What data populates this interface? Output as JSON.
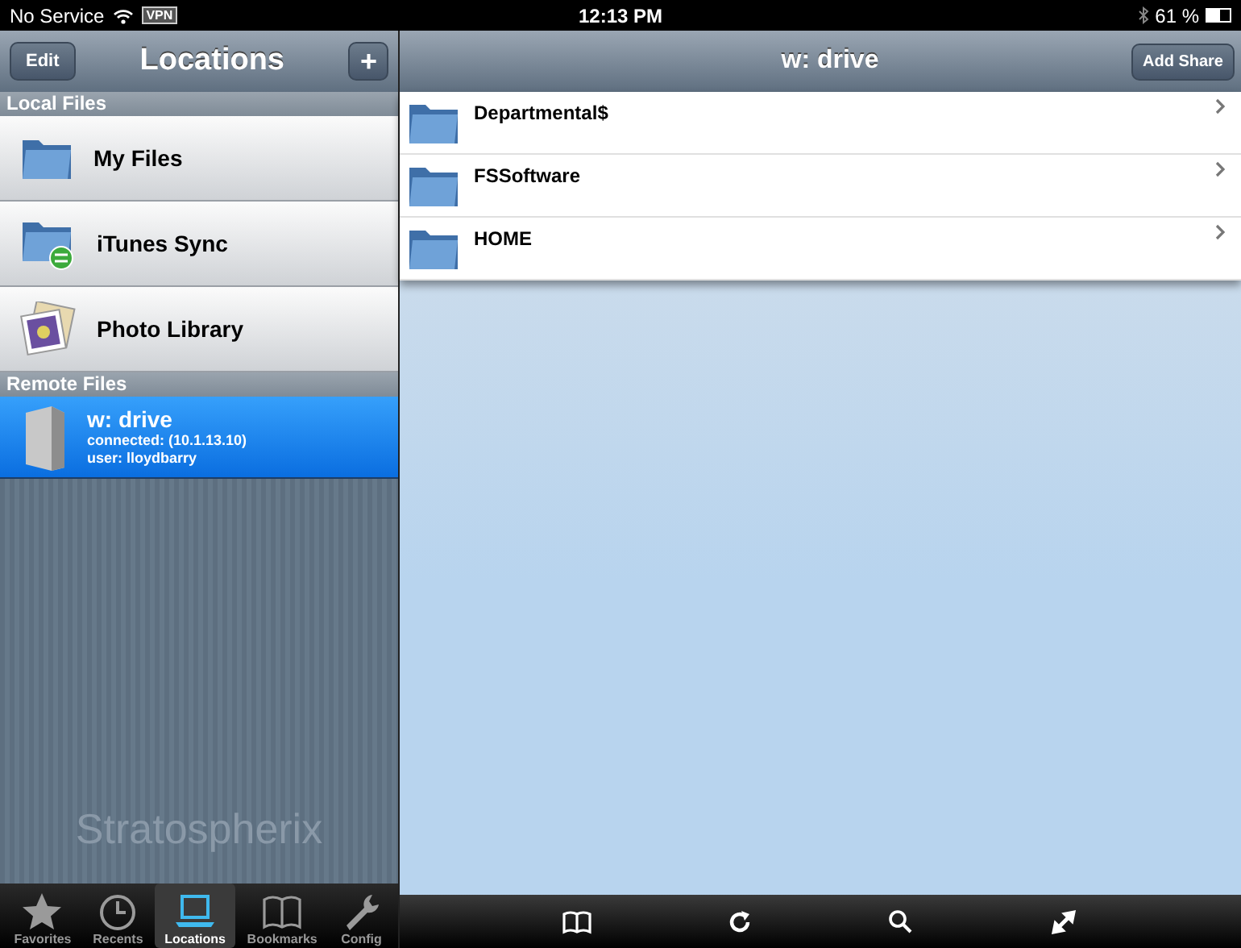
{
  "status_bar": {
    "carrier": "No Service",
    "vpn": "VPN",
    "time": "12:13 PM",
    "battery": "61 %"
  },
  "sidebar": {
    "title": "Locations",
    "edit_button": "Edit",
    "add_button": "+",
    "sections": [
      {
        "header": "Local Files",
        "items": [
          {
            "kind": "folder",
            "title": "My Files",
            "selected": false
          },
          {
            "kind": "sync",
            "title": "iTunes Sync",
            "selected": false
          },
          {
            "kind": "photos",
            "title": "Photo Library",
            "selected": false
          }
        ]
      },
      {
        "header": "Remote Files",
        "items": [
          {
            "kind": "server",
            "title": "w: drive",
            "lines": [
              "connected: (10.1.13.10)",
              "user: lloydbarry"
            ],
            "selected": true
          }
        ]
      }
    ],
    "logo": "Stratospherix"
  },
  "tab_bar": [
    {
      "kind": "star",
      "label": "Favorites",
      "selected": false
    },
    {
      "kind": "clock",
      "label": "Recents",
      "selected": false
    },
    {
      "kind": "laptop",
      "label": "Locations",
      "selected": true
    },
    {
      "kind": "book",
      "label": "Bookmarks",
      "selected": false
    },
    {
      "kind": "wrench",
      "label": "Config",
      "selected": false
    }
  ],
  "detail": {
    "title": "w: drive",
    "add_button": "Add Share",
    "rows": [
      {
        "name": "Departmental$"
      },
      {
        "name": "FSSoftware"
      },
      {
        "name": "HOME"
      }
    ],
    "toolbar": [
      {
        "kind": "book"
      },
      {
        "kind": "refresh"
      },
      {
        "kind": "search"
      },
      {
        "kind": "expand"
      }
    ]
  }
}
